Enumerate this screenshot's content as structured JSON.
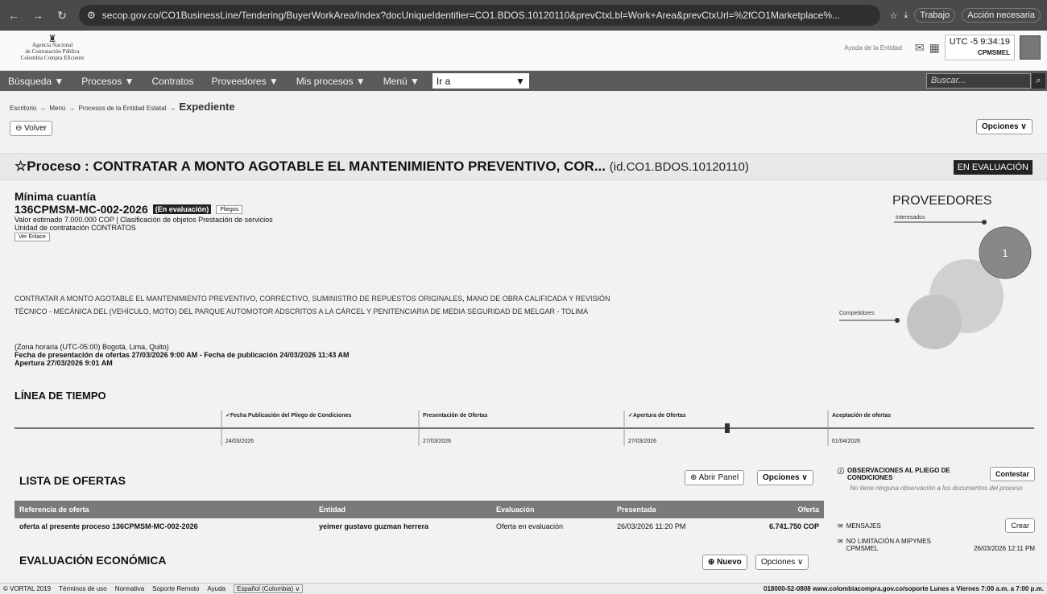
{
  "browser": {
    "url": "secop.gov.co/CO1BusinessLine/Tendering/BuyerWorkArea/Index?docUniqueIdentifier=CO1.BDOS.10120110&prevCtxLbl=Work+Area&prevCtxUrl=%2fCO1Marketplace%...",
    "profile_label": "Trabajo",
    "action_label": "Acción necesaria"
  },
  "header": {
    "logo_lines": [
      "Agencia Nacional",
      "de Contratación Pública",
      "Colombia Compra Eficiente"
    ],
    "help_link": "Ayuda de la Entidad",
    "clock": "UTC -5 9:34:19",
    "user": "CPMSMEL"
  },
  "menu": {
    "items": [
      "Búsqueda ▼",
      "Procesos ▼",
      "Contratos",
      "Proveedores ▼",
      "Mis procesos ▼",
      "Menú ▼"
    ],
    "goto_value": "Ir a",
    "search_placeholder": "Buscar..."
  },
  "breadcrumb": {
    "items": [
      "Escritorio",
      "Menú",
      "Procesos de la Entidad Estatal"
    ],
    "current": "Expediente"
  },
  "buttons": {
    "back": "Volver",
    "options": "Opciones"
  },
  "process": {
    "title": "Proceso : CONTRATAR A MONTO AGOTABLE EL MANTENIMIENTO PREVENTIVO, COR...",
    "id": "(id.CO1.BDOS.10120110)",
    "status": "EN EVALUACIÓN",
    "type": "Mínima cuantía",
    "reference": "136CPMSM-MC-002-2026",
    "ref_status": "(En evaluación)",
    "pliegos_button": "Pliegos",
    "estimated_value": "Valor estimado 7.000.000 COP | Clasificación de objetos  Prestación de servicios",
    "unit": "Unidad de contratación CONTRATOS",
    "link_button": "Ver Enlace",
    "description_1": "CONTRATAR A MONTO AGOTABLE EL MANTENIMIENTO PREVENTIVO, CORRECTIVO, SUMINISTRO DE REPUESTOS ORIGINALES, MANO DE OBRA CALIFICADA Y REVISIÓN",
    "description_2": "TÉCNICO - MECÁNICA DEL (VEHÍCULO, MOTO) DEL PARQUE AUTOMOTOR ADSCRITOS A LA CÁRCEL Y PENITENCIARIA DE MEDIA SEGURIDAD DE MELGAR - TOLIMA",
    "timezone": "(Zona horaria (UTC-05:00) Bogotá, Lima, Quito)",
    "dates_line": "Fecha de presentación de ofertas 27/03/2026 9:00 AM - Fecha de publicación 24/03/2026 11:43 AM",
    "opening": "Apertura 27/03/2026 9:01 AM"
  },
  "suppliers": {
    "title": "PROVEEDORES",
    "interested_label": "Interesados",
    "competitors_label": "Competidores",
    "count": "1"
  },
  "timeline": {
    "title": "LÍNEA DE TIEMPO",
    "events": [
      {
        "label": "✓Fecha Publicación del Pliego de Condiciones",
        "date": "24/03/2026"
      },
      {
        "label": "Presentación de Ofertas",
        "date": "27/03/2026"
      },
      {
        "label": "✓Apertura de Ofertas",
        "date": "27/03/2026"
      },
      {
        "label": "Aceptación de ofertas",
        "date": "01/04/2026"
      }
    ]
  },
  "offers": {
    "title": "LISTA DE OFERTAS",
    "open_panel": "Abrir Panel",
    "options": "Opciones",
    "columns": [
      "Referencia de oferta",
      "Entidad",
      "Evaluación",
      "Presentada",
      "Oferta"
    ],
    "rows": [
      [
        "oferta al presente proceso 136CPMSM-MC-002-2026",
        "yeimer gustavo guzman herrera",
        "Oferta en evaluación",
        "26/03/2026 11:20 PM",
        "6.741.750 COP"
      ]
    ]
  },
  "economic": {
    "title": "EVALUACIÓN ECONÓMICA",
    "new_button": "Nuevo",
    "options": "Opciones"
  },
  "observations": {
    "title": "OBSERVACIONES AL PLIEGO DE CONDICIONES",
    "reply_button": "Contestar",
    "empty_text": "No tiene ninguna observación a los documentos del proceso"
  },
  "messages": {
    "title": "MENSAJES",
    "create_button": "Crear",
    "item_title": "NO LIMITACIÓN A MIPYMES",
    "item_sender": "CPMSMEL",
    "item_time": "26/03/2026 12:11 PM"
  },
  "footer": {
    "left": [
      "© VORTAL 2019",
      "Términos de uso",
      "Normativa",
      "Soporte Remoto",
      "Ayuda"
    ],
    "language": "Español (Colombia)",
    "right": "018000-52-0808 www.colombiacompra.gov.co/soporte  Lunes a Viernes 7:00 a.m. a 7:00 p.m."
  }
}
